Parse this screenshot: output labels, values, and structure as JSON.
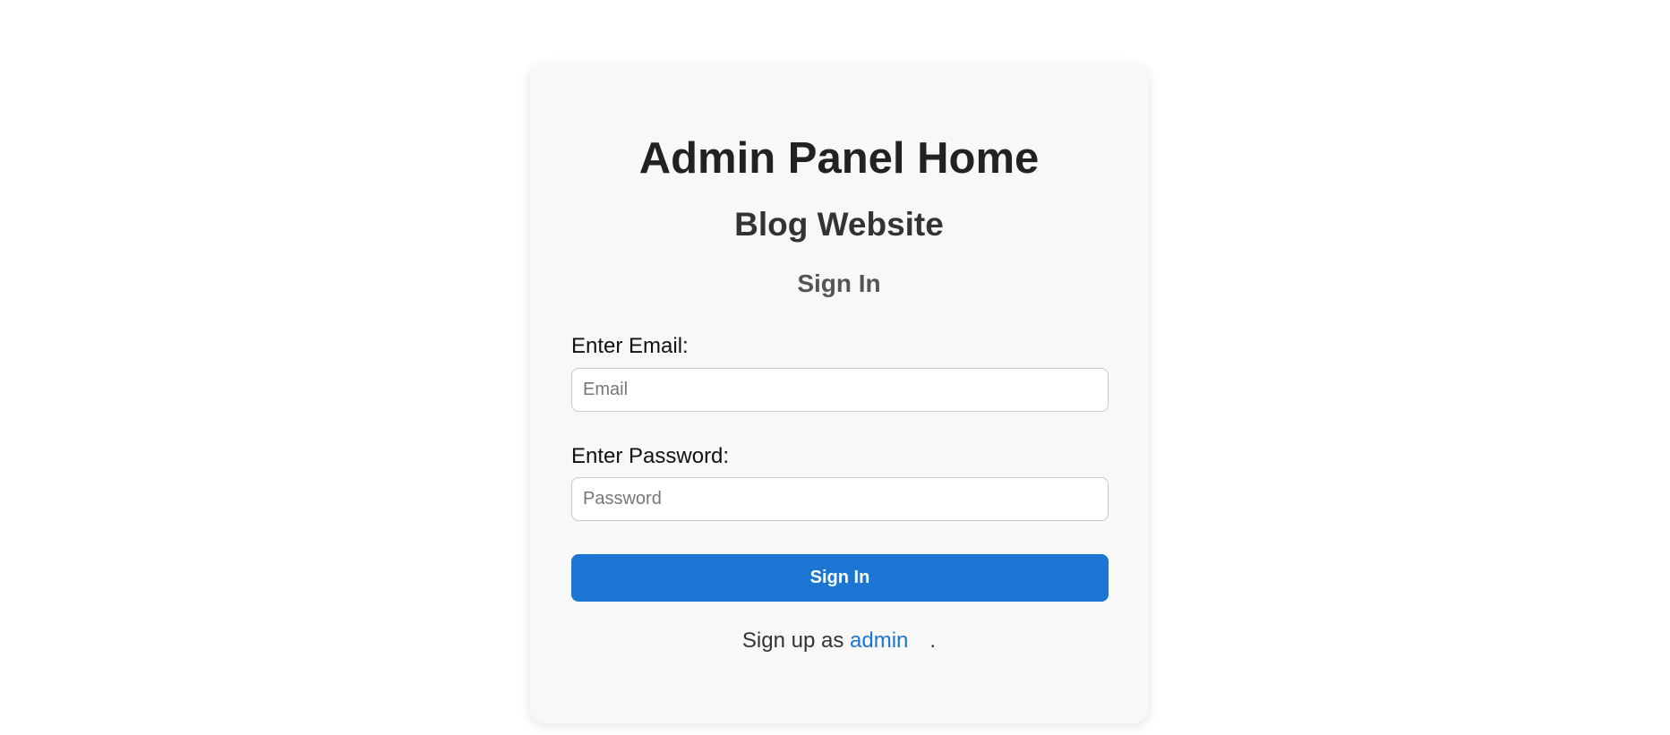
{
  "card": {
    "title": "Admin Panel Home",
    "subtitle": "Blog Website",
    "form_heading": "Sign In"
  },
  "form": {
    "email": {
      "label": "Enter Email:",
      "value": "",
      "placeholder": "Email"
    },
    "password": {
      "label": "Enter Password:",
      "value": "",
      "placeholder": "Password"
    },
    "submit_label": "Sign In"
  },
  "signup": {
    "prefix": "Sign up as ",
    "link_text": "admin",
    "suffix": "."
  },
  "colors": {
    "accent": "#1a76d2",
    "card_background": "#f8f8f8",
    "page_background": "#ffffff"
  }
}
